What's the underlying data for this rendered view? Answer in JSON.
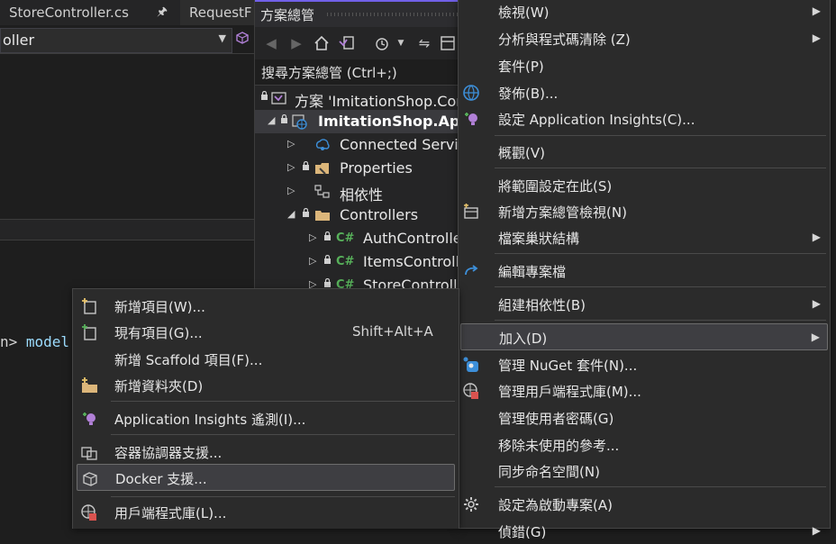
{
  "editor": {
    "tabs": [
      {
        "label": "StoreController.cs",
        "pin": "🖈"
      },
      {
        "label": "RequestF"
      }
    ],
    "nav_combo_text": "oller",
    "code_line": {
      "op": "n>",
      "word": " model"
    }
  },
  "solution_explorer": {
    "title": "方案總管",
    "search_placeholder": "搜尋方案總管 (Ctrl+;)",
    "items": [
      {
        "label": "方案 'ImitationShop.Con"
      },
      {
        "label": "ImitationShop.Api"
      },
      {
        "label": "Connected Servic"
      },
      {
        "label": "Properties"
      },
      {
        "label": "相依性"
      },
      {
        "label": "Controllers"
      },
      {
        "label": "AuthControlle",
        "badge": "C#"
      },
      {
        "label": "ItemsControll",
        "badge": "C#"
      },
      {
        "label": "StoreControll",
        "badge": "C#"
      }
    ]
  },
  "context_menu": {
    "items": [
      {
        "label": "檢視(W)"
      },
      {
        "label": "分析與程式碼清除 (Z)"
      },
      {
        "label": "套件(P)"
      },
      {
        "label": "發佈(B)..."
      },
      {
        "label": "設定 Application Insights(C)..."
      },
      {
        "label": "概觀(V)"
      },
      {
        "label": "將範圍設定在此(S)"
      },
      {
        "label": "新增方案總管檢視(N)"
      },
      {
        "label": "檔案巢狀結構"
      },
      {
        "label": "編輯專案檔"
      },
      {
        "label": "組建相依性(B)"
      },
      {
        "label": "加入(D)"
      },
      {
        "label": "管理 NuGet 套件(N)..."
      },
      {
        "label": "管理用戶端程式庫(M)..."
      },
      {
        "label": "管理使用者密碼(G)"
      },
      {
        "label": "移除未使用的參考..."
      },
      {
        "label": "同步命名空間(N)"
      },
      {
        "label": "設定為啟動專案(A)"
      },
      {
        "label": "偵錯(G)"
      }
    ],
    "submenu_arrow": "▶"
  },
  "add_submenu": {
    "items": [
      {
        "label": "新增項目(W)..."
      },
      {
        "label": "現有項目(G)...",
        "shortcut": "Shift+Alt+A"
      },
      {
        "label": "新增 Scaffold 項目(F)..."
      },
      {
        "label": "新增資料夾(D)"
      },
      {
        "label": "Application Insights 遙測(I)..."
      },
      {
        "label": "容器協調器支援..."
      },
      {
        "label": "Docker 支援..."
      },
      {
        "label": "用戶端程式庫(L)..."
      }
    ]
  },
  "colors": {
    "accent": "#7160e8",
    "csharp_badge": "#57b05a",
    "background": "#1e1e1e",
    "menu_bg": "#2b2b2b"
  }
}
